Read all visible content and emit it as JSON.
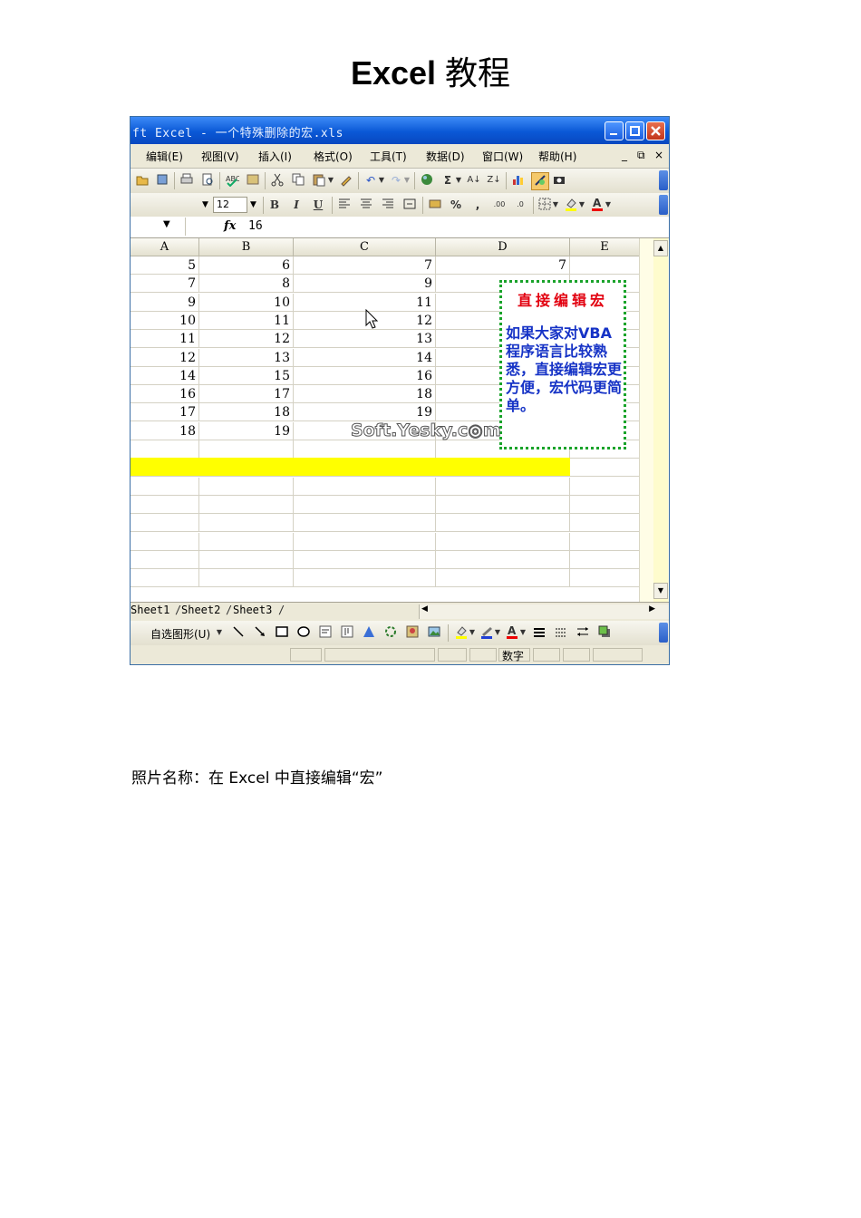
{
  "document": {
    "title_latin": "Excel",
    "title_cjk": "教程",
    "caption": "照片名称：在 Excel 中直接编辑“宏”"
  },
  "window": {
    "title": "ft Excel - 一个特殊删除的宏.xls",
    "buttons": [
      "minimize",
      "restore",
      "close"
    ]
  },
  "menubar": {
    "items": [
      "编辑(E)",
      "视图(V)",
      "插入(I)",
      "格式(O)",
      "工具(T)",
      "数据(D)",
      "窗口(W)",
      "帮助(H)"
    ],
    "mdi_controls": [
      "_",
      "⧉",
      "×"
    ]
  },
  "toolbar_format": {
    "font_size": "12",
    "bold": "B",
    "italic": "I",
    "underline": "U",
    "percent": "%",
    "comma": ",",
    "sigma": "Σ"
  },
  "formula_bar": {
    "fx": "fx",
    "value": "16"
  },
  "sheet": {
    "columns": [
      "A",
      "B",
      "C",
      "D",
      "E"
    ],
    "rows": [
      [
        "5",
        "6",
        "7",
        "7"
      ],
      [
        "7",
        "8",
        "9",
        ""
      ],
      [
        "9",
        "10",
        "11",
        ""
      ],
      [
        "10",
        "11",
        "12",
        ""
      ],
      [
        "11",
        "12",
        "13",
        ""
      ],
      [
        "12",
        "13",
        "14",
        ""
      ],
      [
        "14",
        "15",
        "16",
        ""
      ],
      [
        "16",
        "17",
        "18",
        ""
      ],
      [
        "17",
        "18",
        "19",
        ""
      ],
      [
        "18",
        "19",
        "",
        ""
      ]
    ],
    "highlight_color": "#ffff00"
  },
  "note": {
    "title": "直接编辑宏",
    "body": "如果大家对VBA程序语言比较熟悉，直接编辑宏更方便，宏代码更简单。",
    "border_color": "#19a32a",
    "title_color": "#e2000f",
    "body_color": "#1633c6"
  },
  "watermark": "Soft.Yesky.c◎m",
  "sheet_tabs": [
    "Sheet1",
    "Sheet2",
    "Sheet3"
  ],
  "drawing_toolbar": {
    "autoshapes_label": "自选图形(U)"
  },
  "status_bar": {
    "mode": "数字"
  }
}
